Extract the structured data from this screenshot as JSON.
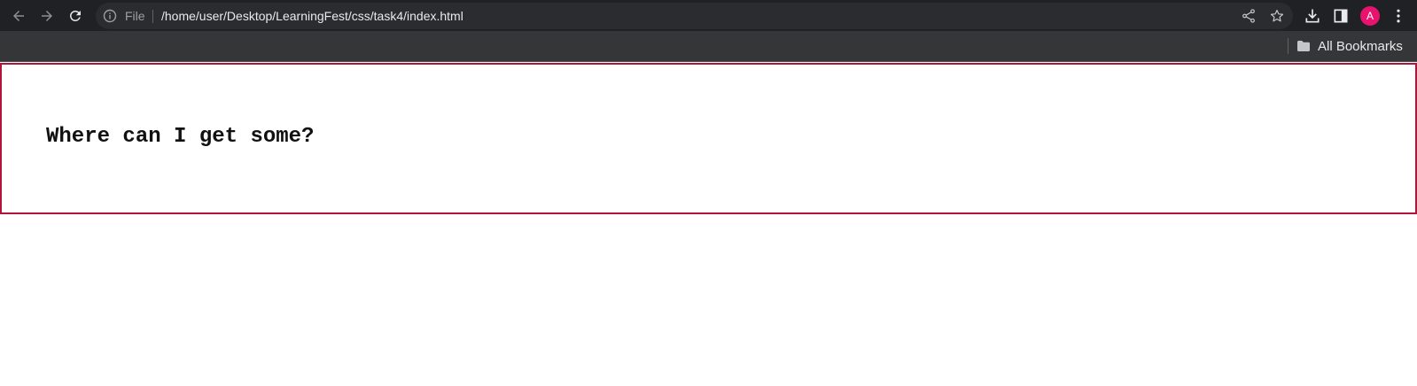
{
  "browser": {
    "omnibox": {
      "scheme_label": "File",
      "url": "/home/user/Desktop/LearningFest/css/task4/index.html"
    },
    "profile_initial": "A",
    "bookmarks_bar": {
      "all_bookmarks_label": "All Bookmarks"
    }
  },
  "page": {
    "heading": "Where can I get some?"
  },
  "colors": {
    "toolbar_bg": "#202124",
    "omnibox_bg": "#2b2c2f",
    "bookmarks_bg": "#353638",
    "avatar": "#e8136f",
    "box_border": "#b1143a"
  },
  "icons": [
    "back-arrow-icon",
    "forward-arrow-icon",
    "reload-icon",
    "info-icon",
    "share-icon",
    "star-icon",
    "download-icon",
    "side-panel-icon",
    "kebab-menu-icon",
    "folder-icon"
  ]
}
